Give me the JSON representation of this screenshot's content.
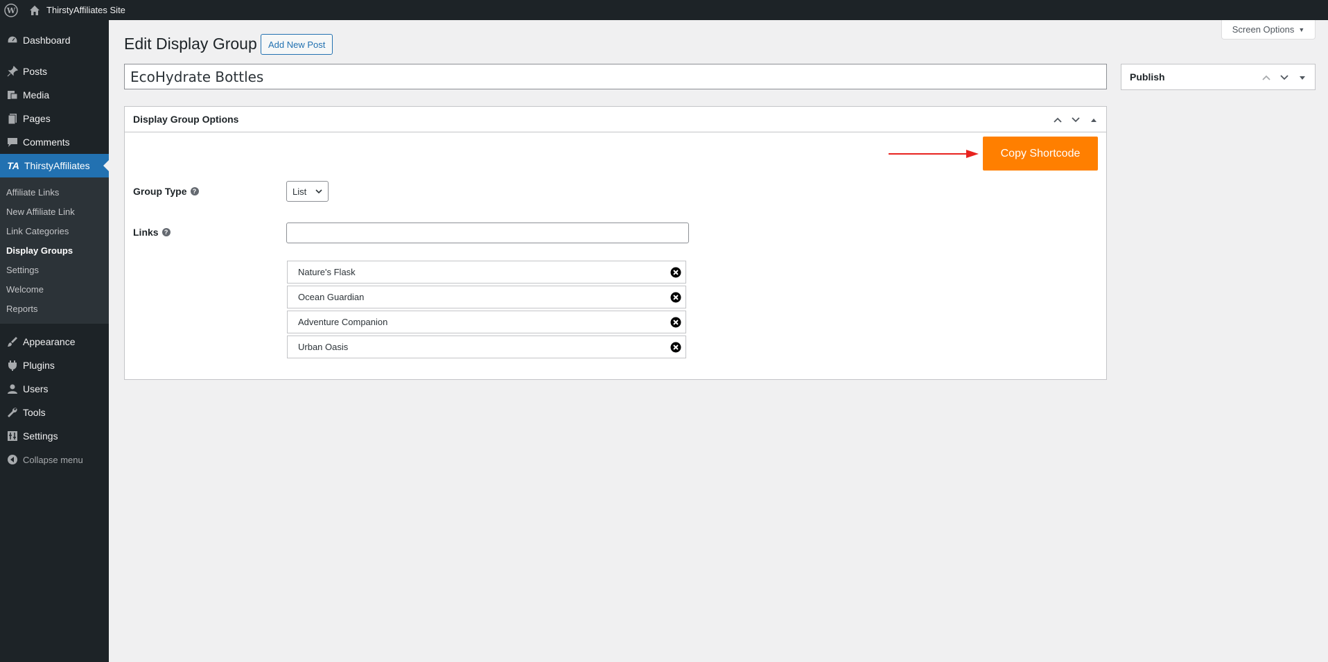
{
  "adminbar": {
    "site_name": "ThirstyAffiliates Site"
  },
  "sidebar": {
    "items": [
      {
        "label": "Dashboard",
        "icon": "dashboard-icon"
      },
      {
        "label": "Posts",
        "icon": "pin-icon"
      },
      {
        "label": "Media",
        "icon": "media-icon"
      },
      {
        "label": "Pages",
        "icon": "pages-icon"
      },
      {
        "label": "Comments",
        "icon": "comments-icon"
      },
      {
        "label": "ThirstyAffiliates",
        "icon": "ta-logo-icon"
      }
    ],
    "submenu": [
      "Affiliate Links",
      "New Affiliate Link",
      "Link Categories",
      "Display Groups",
      "Settings",
      "Welcome",
      "Reports"
    ],
    "items_after": [
      {
        "label": "Appearance",
        "icon": "brush-icon"
      },
      {
        "label": "Plugins",
        "icon": "plugin-icon"
      },
      {
        "label": "Users",
        "icon": "users-icon"
      },
      {
        "label": "Tools",
        "icon": "wrench-icon"
      },
      {
        "label": "Settings",
        "icon": "settings-icon"
      }
    ],
    "collapse_label": "Collapse menu"
  },
  "header": {
    "screen_options": "Screen Options",
    "page_title": "Edit Display Group",
    "add_new": "Add New Post"
  },
  "post": {
    "title_value": "EcoHydrate Bottles"
  },
  "publish_box": {
    "title": "Publish"
  },
  "options_box": {
    "title": "Display Group Options",
    "copy_shortcode": "Copy Shortcode",
    "group_type_label": "Group Type",
    "group_type_value": "List",
    "links_label": "Links",
    "links": [
      "Nature's Flask",
      "Ocean Guardian",
      "Adventure Companion",
      "Urban Oasis"
    ]
  },
  "colors": {
    "accent": "#2271b1",
    "copy_button": "#ff7f00",
    "sidebar_bg": "#1d2327",
    "arrow": "#e8231f"
  }
}
